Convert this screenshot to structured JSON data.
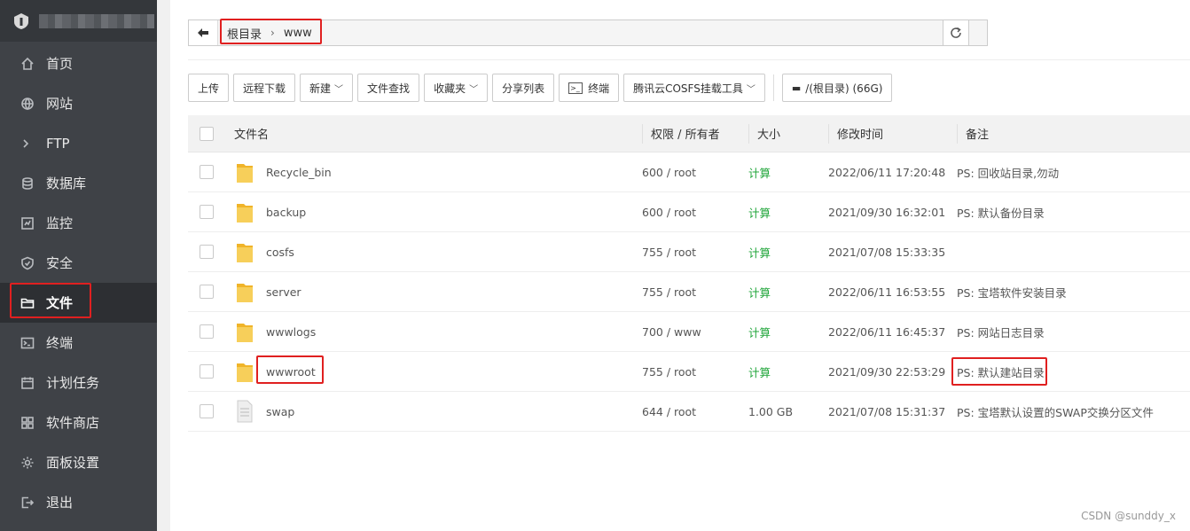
{
  "sidebar": {
    "items": [
      {
        "label": "首页",
        "icon": "home-icon"
      },
      {
        "label": "网站",
        "icon": "globe-icon"
      },
      {
        "label": "FTP",
        "icon": "ftp-icon"
      },
      {
        "label": "数据库",
        "icon": "database-icon"
      },
      {
        "label": "监控",
        "icon": "monitor-icon"
      },
      {
        "label": "安全",
        "icon": "shield-icon"
      },
      {
        "label": "文件",
        "icon": "folder-icon",
        "active": true
      },
      {
        "label": "终端",
        "icon": "terminal-icon"
      },
      {
        "label": "计划任务",
        "icon": "calendar-icon"
      },
      {
        "label": "软件商店",
        "icon": "grid-icon"
      },
      {
        "label": "面板设置",
        "icon": "gear-icon"
      },
      {
        "label": "退出",
        "icon": "logout-icon"
      }
    ]
  },
  "path": {
    "root": "根目录",
    "separator": "›",
    "current": "www"
  },
  "toolbar": {
    "upload": "上传",
    "remote_download": "远程下载",
    "new": "新建",
    "search": "文件查找",
    "favorites": "收藏夹",
    "share_list": "分享列表",
    "terminal": "终端",
    "cosfs_tool": "腾讯云COSFS挂载工具",
    "disk": "/(根目录) (66G)"
  },
  "table": {
    "headers": {
      "name": "文件名",
      "perm": "权限 / 所有者",
      "size": "大小",
      "mtime": "修改时间",
      "note": "备注"
    },
    "rows": [
      {
        "type": "folder",
        "name": "Recycle_bin",
        "perm": "600 / root",
        "size": "计算",
        "mtime": "2022/06/11 17:20:48",
        "note": "PS: 回收站目录,勿动"
      },
      {
        "type": "folder",
        "name": "backup",
        "perm": "600 / root",
        "size": "计算",
        "mtime": "2021/09/30 16:32:01",
        "note": "PS: 默认备份目录"
      },
      {
        "type": "folder",
        "name": "cosfs",
        "perm": "755 / root",
        "size": "计算",
        "mtime": "2021/07/08 15:33:35",
        "note": ""
      },
      {
        "type": "folder",
        "name": "server",
        "perm": "755 / root",
        "size": "计算",
        "mtime": "2022/06/11 16:53:55",
        "note": "PS: 宝塔软件安装目录"
      },
      {
        "type": "folder",
        "name": "wwwlogs",
        "perm": "700 / www",
        "size": "计算",
        "mtime": "2022/06/11 16:45:37",
        "note": "PS: 网站日志目录"
      },
      {
        "type": "folder",
        "name": "wwwroot",
        "perm": "755 / root",
        "size": "计算",
        "mtime": "2021/09/30 22:53:29",
        "note": "PS: 默认建站目录"
      },
      {
        "type": "file",
        "name": "swap",
        "perm": "644 / root",
        "size": "1.00 GB",
        "mtime": "2021/07/08 15:31:37",
        "note": "PS: 宝塔默认设置的SWAP交换分区文件"
      }
    ]
  },
  "watermark": "CSDN @sunddy_x",
  "colors": {
    "sidebar_bg": "#3f4247",
    "highlight_red": "#e02020",
    "calc_green": "#20a53a",
    "folder_yellow": "#f5c542"
  }
}
